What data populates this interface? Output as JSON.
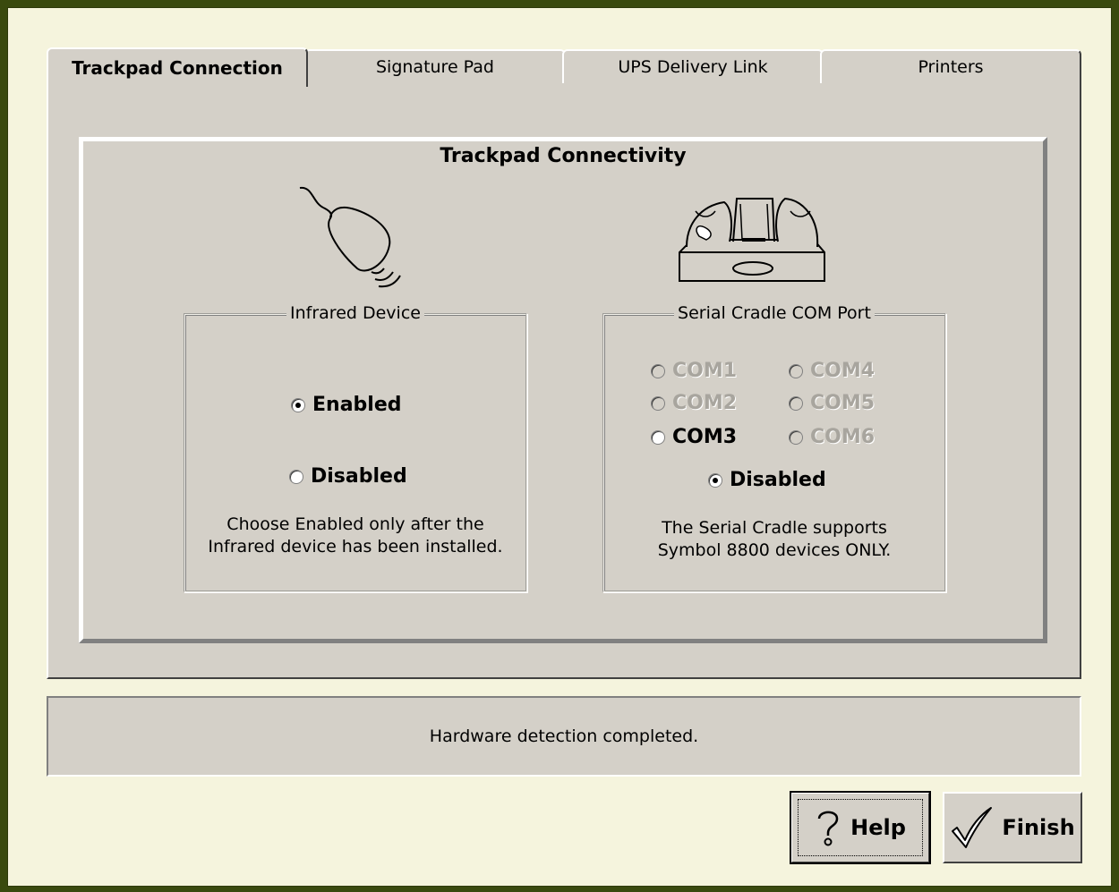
{
  "tabs": [
    {
      "label": "Trackpad Connection",
      "active": true
    },
    {
      "label": "Signature Pad",
      "active": false
    },
    {
      "label": "UPS Delivery Link",
      "active": false
    },
    {
      "label": "Printers",
      "active": false
    }
  ],
  "main": {
    "title": "Trackpad Connectivity",
    "infrared": {
      "legend": "Infrared Device",
      "options": [
        {
          "label": "Enabled",
          "checked": true
        },
        {
          "label": "Disabled",
          "checked": false
        }
      ],
      "note_line1": "Choose Enabled only after the",
      "note_line2": "Infrared device has been installed."
    },
    "serial": {
      "legend": "Serial Cradle COM Port",
      "ports": [
        {
          "label": "COM1",
          "enabled": false,
          "checked": false
        },
        {
          "label": "COM2",
          "enabled": false,
          "checked": false
        },
        {
          "label": "COM3",
          "enabled": true,
          "checked": false
        },
        {
          "label": "COM4",
          "enabled": false,
          "checked": false
        },
        {
          "label": "COM5",
          "enabled": false,
          "checked": false
        },
        {
          "label": "COM6",
          "enabled": false,
          "checked": false
        }
      ],
      "disabled_option": {
        "label": "Disabled",
        "checked": true
      },
      "note_line1": "The Serial Cradle supports",
      "note_line2": "Symbol 8800 devices ONLY."
    }
  },
  "status": {
    "text": "Hardware detection completed."
  },
  "buttons": {
    "help": {
      "label": "Help",
      "icon": "question-icon"
    },
    "finish": {
      "label": "Finish",
      "icon": "checkmark-icon"
    }
  },
  "colors": {
    "window_border": "#3a4a0e",
    "window_bg": "#f5f4dd",
    "dialog_face": "#d4d0c8"
  }
}
